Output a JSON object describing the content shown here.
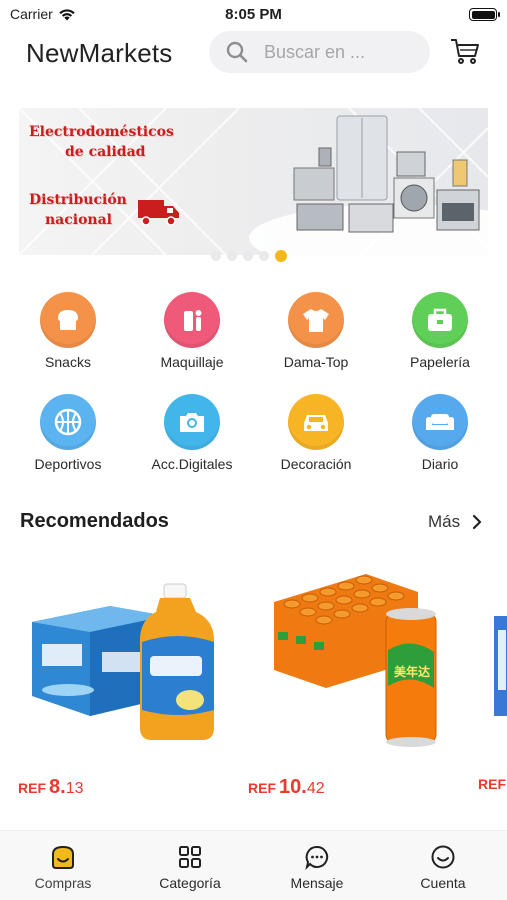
{
  "status_bar": {
    "carrier": "Carrier",
    "time": "8:05 PM"
  },
  "header": {
    "title": "NewMarkets",
    "search_placeholder": "Buscar en ...",
    "cart_icon": "cart-icon"
  },
  "banner": {
    "line1": "Electrodomésticos",
    "line2": "de calidad",
    "line3": "Distribución",
    "line4": "nacional",
    "slides": 5,
    "active_slide": 5
  },
  "categories": [
    {
      "label": "Snacks",
      "icon": "bread-icon",
      "color": "#f5924a"
    },
    {
      "label": "Maquillaje",
      "icon": "makeup-icon",
      "color": "#ef5a7b"
    },
    {
      "label": "Dama-Top",
      "icon": "shirt-icon",
      "color": "#f5924a"
    },
    {
      "label": "Papelería",
      "icon": "briefcase-icon",
      "color": "#5fcf57"
    },
    {
      "label": "Deportivos",
      "icon": "basketball-icon",
      "color": "#5bb3ef"
    },
    {
      "label": "Acc.Digitales",
      "icon": "camera-icon",
      "color": "#42b6ea"
    },
    {
      "label": "Decoración",
      "icon": "car-icon",
      "color": "#f7b526"
    },
    {
      "label": "Diario",
      "icon": "sofa-icon",
      "color": "#57a9ee"
    }
  ],
  "section": {
    "title": "Recomendados",
    "more_label": "Más"
  },
  "products": [
    {
      "currency": "REF",
      "price_int": "8.",
      "price_dec": "13"
    },
    {
      "currency": "REF",
      "price_int": "10.",
      "price_dec": "42"
    },
    {
      "currency": "REF",
      "price_int": "",
      "price_dec": ""
    }
  ],
  "tabs": [
    {
      "label": "Compras",
      "icon": "shop-icon",
      "active": true
    },
    {
      "label": "Categoría",
      "icon": "grid-icon",
      "active": false
    },
    {
      "label": "Mensaje",
      "icon": "chat-icon",
      "active": false
    },
    {
      "label": "Cuenta",
      "icon": "smile-icon",
      "active": false
    }
  ],
  "colors": {
    "accent": "#f2b91d",
    "price": "#e83b2f",
    "banner_text": "#c81e1e"
  }
}
